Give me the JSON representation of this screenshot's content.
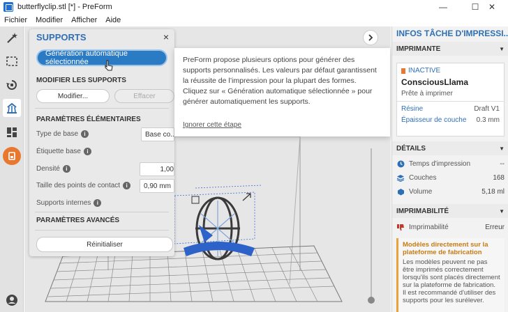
{
  "window": {
    "title": "butterflyclip.stl [*] - PreForm",
    "minimize": "—",
    "maximize": "☐",
    "close": "✕"
  },
  "menu": [
    "Fichier",
    "Modifier",
    "Afficher",
    "Aide"
  ],
  "supports_panel": {
    "title": "SUPPORTS",
    "close": "×",
    "auto_button": "Génération automatique sélectionnée",
    "modify_section": "MODIFIER LES SUPPORTS",
    "modify_button": "Modifier...",
    "erase_button": "Effacer",
    "basic_section": "PARAMÈTRES ÉLÉMENTAIRES",
    "base_type_label": "Type de base",
    "base_type_value": "Base co...",
    "base_label_label": "Étiquette base",
    "density_label": "Densité",
    "density_value": "1,00",
    "touchpoint_label": "Taille des points de contact",
    "touchpoint_value": "0,90 mm",
    "internal_label": "Supports internes",
    "advanced_section": "PARAMÈTRES AVANCÉS",
    "reset_button": "Réinitialiser"
  },
  "popover": {
    "text": "PreForm propose plusieurs options pour générer des supports personnalisés. Les valeurs par défaut garantissent la réussite de l’impression pour la plupart des formes. Cliquez sur « Génération automatique sélectionnée » pour générer automatiquement les supports.",
    "skip": "Ignorer cette étape"
  },
  "job_panel": {
    "title": "INFOS TÂCHE D'IMPRESSI...",
    "printer_section": "IMPRIMANTE",
    "printer_status": "INACTIVE",
    "printer_name": "ConsciousLlama",
    "printer_state": "Prête à imprimer",
    "resin_label": "Résine",
    "resin_value": "Draft V1",
    "layer_thickness_label": "Épaisseur de couche",
    "layer_thickness_value": "0.3 mm",
    "details_section": "DÉTAILS",
    "print_time_label": "Temps d'impression",
    "print_time_value": "--",
    "layers_label": "Couches",
    "layers_value": "168",
    "volume_label": "Volume",
    "volume_value": "5,18 ml",
    "printability_section": "IMPRIMABILITÉ",
    "printability_label": "Imprimabilité",
    "printability_value": "Erreur",
    "warning_title": "Modèles directement sur la plateforme de fabrication",
    "warning_body": "Les modèles peuvent ne pas être imprimés correctement lorsqu'ils sont placés directement sur la plateforme de fabrication. Il est recommandé d'utiliser des supports pour les surélever."
  },
  "colors": {
    "accent": "#2f6fb5",
    "orange": "#e8782f",
    "error": "#c0392b",
    "warning": "#e8a33a"
  },
  "icons": [
    "magic-wand-icon",
    "select-icon",
    "orient-icon",
    "supports-icon",
    "layout-icon",
    "printer-icon",
    "account-icon",
    "chevron-right-icon",
    "info-icon",
    "chevron-down-icon",
    "clock-icon",
    "layers-icon",
    "volume-icon",
    "thumbs-down-icon"
  ]
}
